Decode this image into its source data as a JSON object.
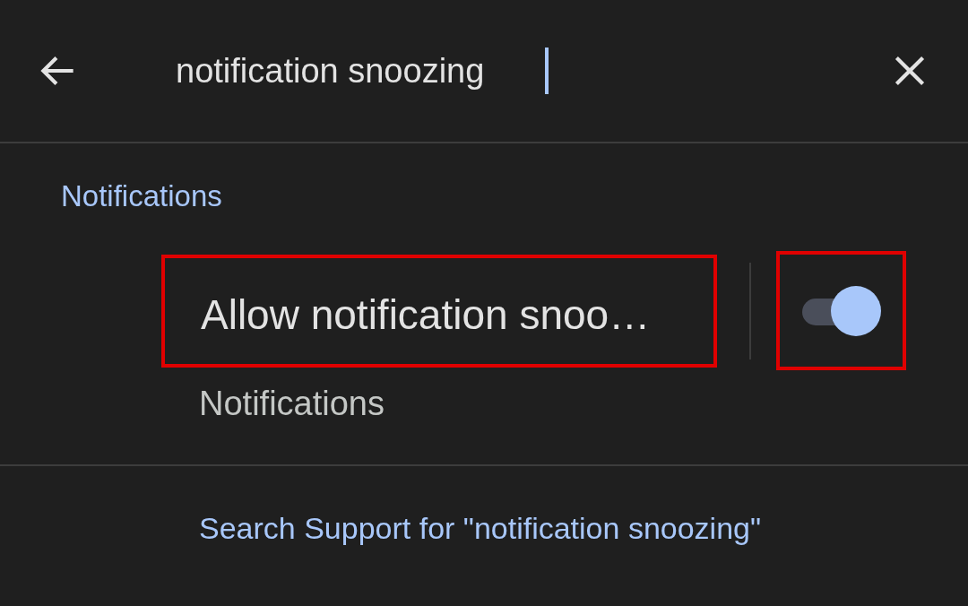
{
  "search": {
    "value": "notification snoozing"
  },
  "section": {
    "title": "Notifications"
  },
  "results": [
    {
      "title": "Allow notification snoo…",
      "subtitle": "Notifications",
      "on": true,
      "highlighted": true
    }
  ],
  "support_link": "Search Support for \"notification snoozing\""
}
